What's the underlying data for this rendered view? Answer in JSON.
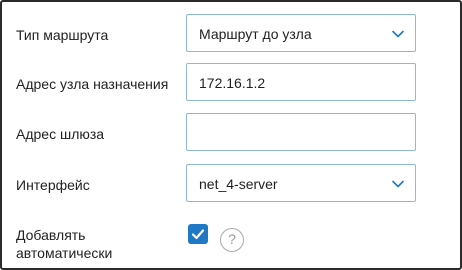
{
  "form": {
    "route_type": {
      "label": "Тип маршрута",
      "value": "Маршрут до узла"
    },
    "destination": {
      "label": "Адрес узла назначения",
      "value": "172.16.1.2"
    },
    "gateway": {
      "label": "Адрес шлюза",
      "value": ""
    },
    "interface": {
      "label": "Интерфейс",
      "value": "net_4-server"
    },
    "auto_add": {
      "label_line1": "Добавлять",
      "label_line2": "автоматически",
      "checked": true,
      "help_symbol": "?"
    }
  },
  "colors": {
    "accent": "#1e78c6",
    "input_border": "#8fb7d6",
    "frame_border": "#2b2b2b"
  },
  "icons": {
    "dropdown": "chevron-down-icon",
    "checkbox": "check-icon",
    "help": "help-circle-icon"
  }
}
